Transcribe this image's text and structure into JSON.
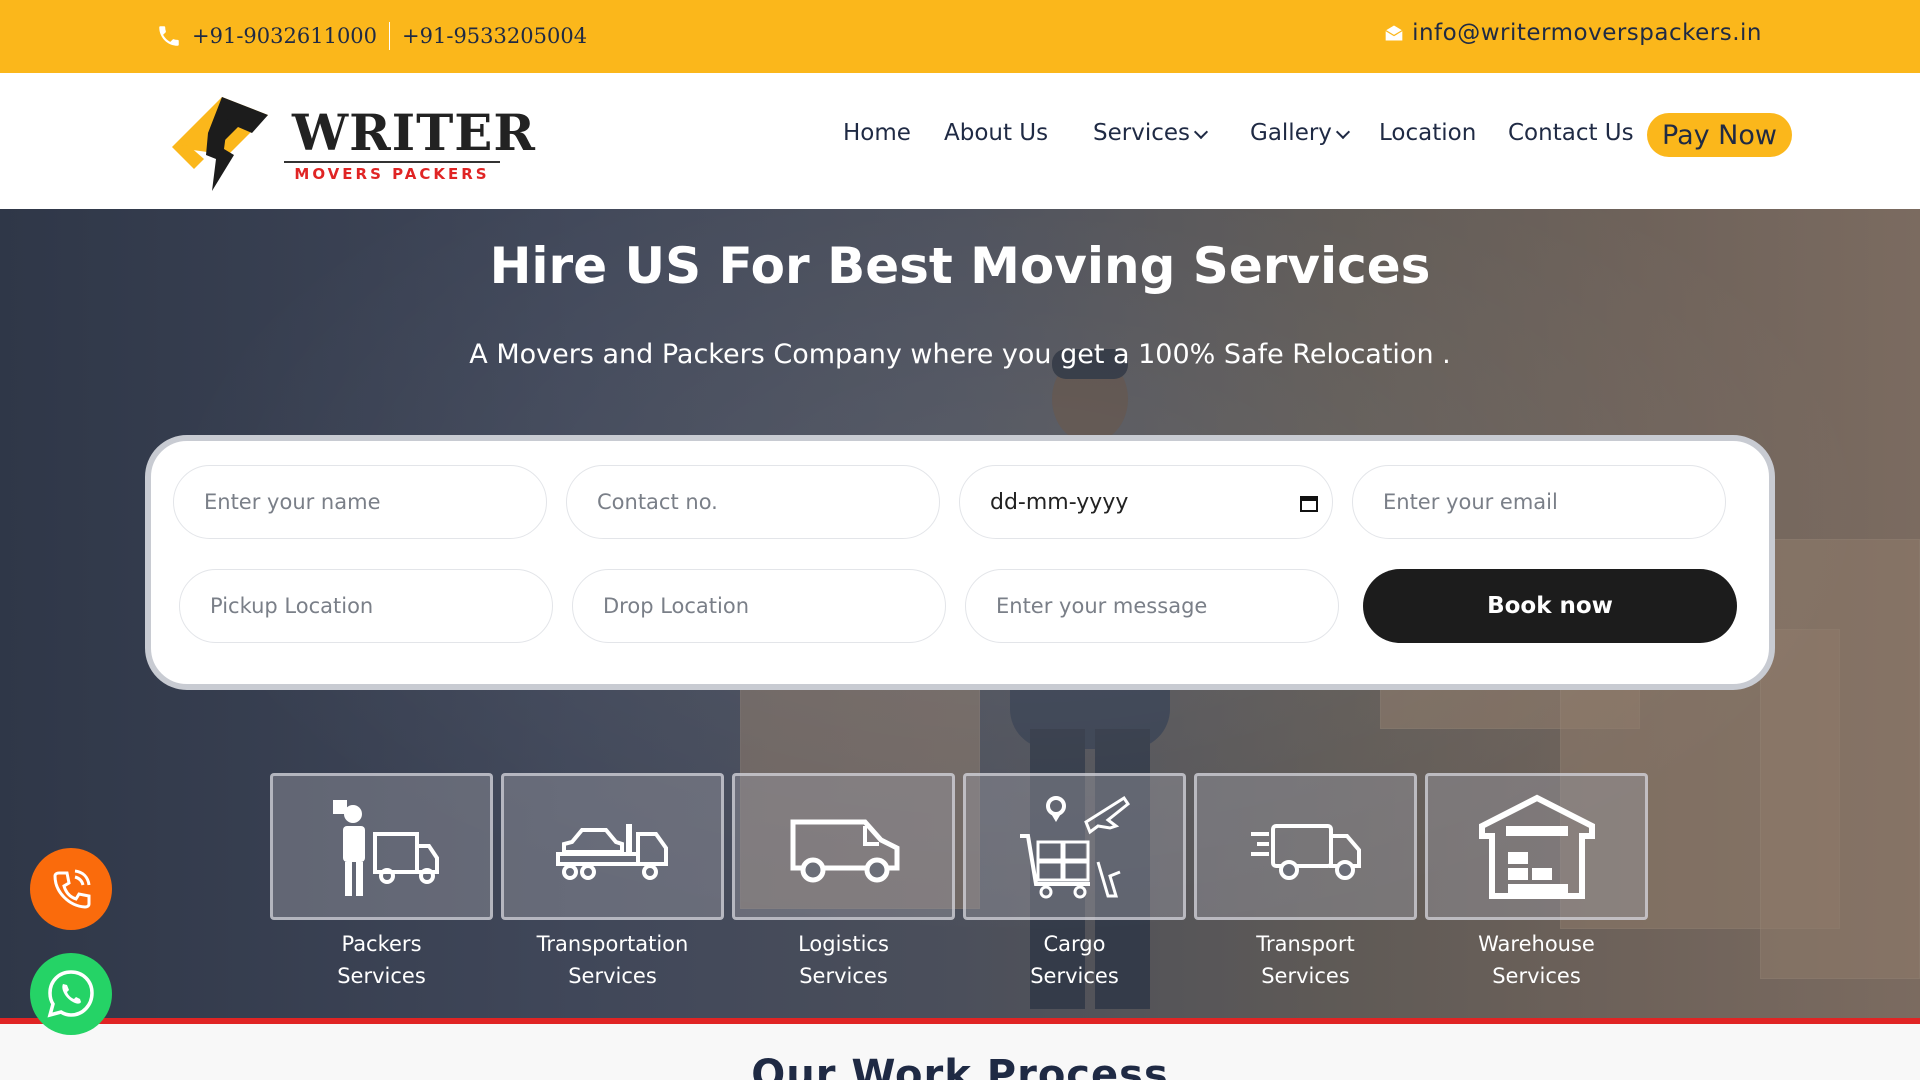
{
  "topbar": {
    "phone1": "+91-9032611000",
    "phone2": "+91-9533205004",
    "email": "info@writermoverspackers.in"
  },
  "brand": {
    "name": "WRITER",
    "tagline": "MOVERS PACKERS",
    "colors": {
      "accent": "#fbb71b",
      "red": "#e02424",
      "dark": "#1f2a44"
    }
  },
  "nav": {
    "home": "Home",
    "about": "About Us",
    "services": "Services",
    "gallery": "Gallery",
    "location": "Location",
    "contact": "Contact Us",
    "pay": "Pay Now"
  },
  "hero": {
    "title": "Hire US For Best Moving Services",
    "subtitle": "A Movers and Packers Company where you get a 100% Safe Relocation ."
  },
  "form": {
    "name_placeholder": "Enter your name",
    "contact_placeholder": "Contact no.",
    "date_value": "dd-mm-yyyy",
    "email_placeholder": "Enter your email",
    "pickup_placeholder": "Pickup Location",
    "drop_placeholder": "Drop Location",
    "message_placeholder": "Enter your message",
    "book_label": "Book now"
  },
  "services": [
    {
      "line1": "Packers",
      "line2": "Services",
      "icon": "packer-icon"
    },
    {
      "line1": "Transportation",
      "line2": "Services",
      "icon": "car-carrier-icon"
    },
    {
      "line1": "Logistics",
      "line2": "Services",
      "icon": "van-icon"
    },
    {
      "line1": "Cargo",
      "line2": "Services",
      "icon": "cargo-icon"
    },
    {
      "line1": "Transport",
      "line2": "Services",
      "icon": "fast-truck-icon"
    },
    {
      "line1": "Warehouse",
      "line2": "Services",
      "icon": "warehouse-icon"
    }
  ],
  "section": {
    "work_process_title": "Our Work Process"
  }
}
